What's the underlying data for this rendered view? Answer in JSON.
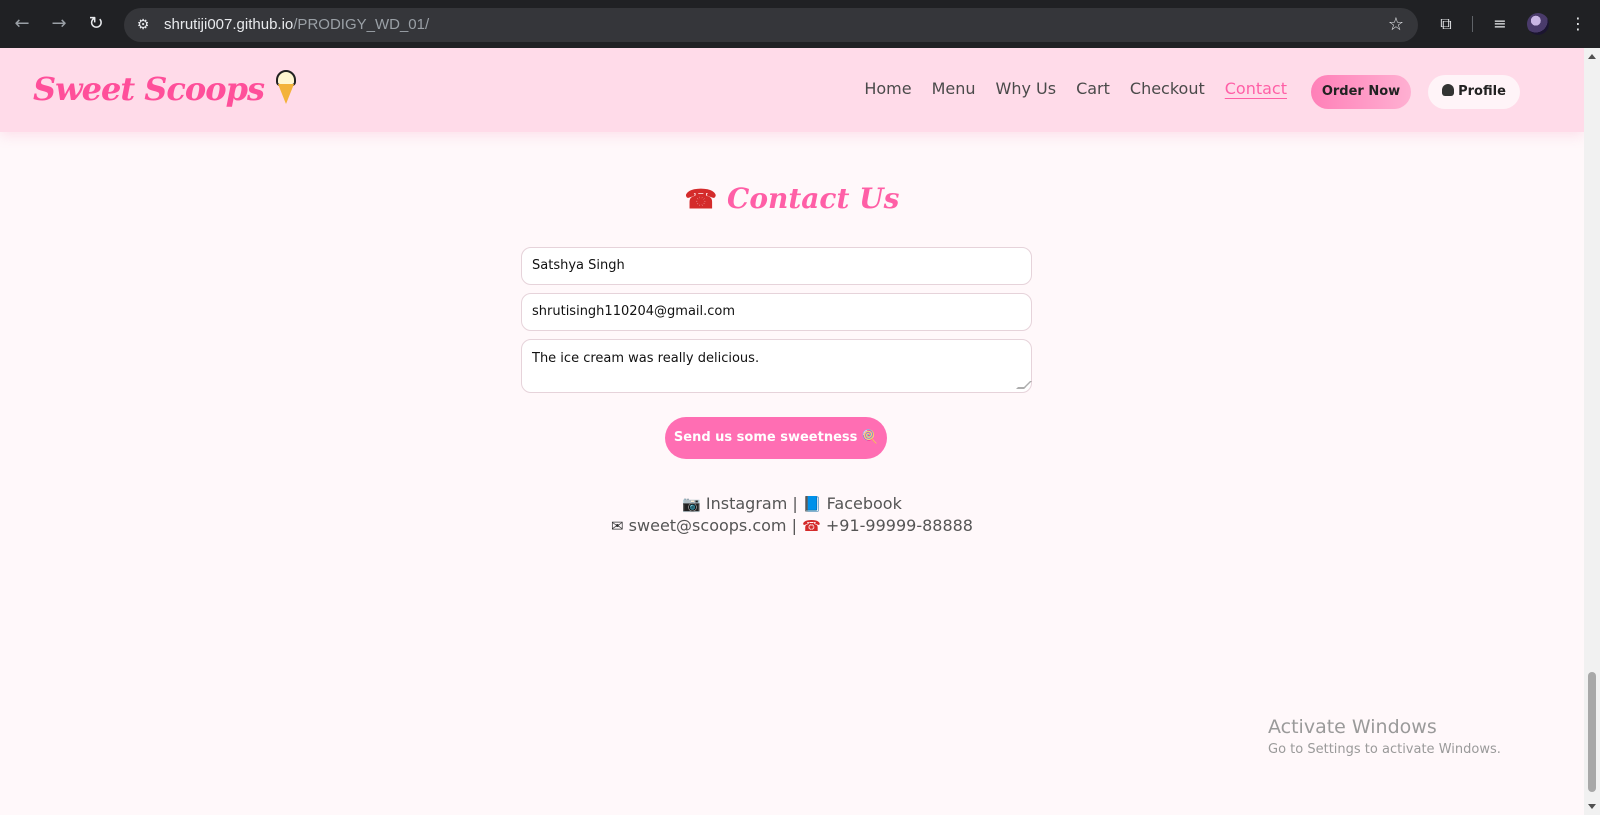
{
  "browser": {
    "url_host": "shrutiji007.github.io",
    "url_path": "/PRODIGY_WD_01/",
    "icons": [
      "back-icon",
      "forward-icon",
      "reload-icon",
      "site-settings-icon",
      "bookmark-star-icon",
      "extensions-icon",
      "media-controls-icon",
      "profile-avatar",
      "menu-icon"
    ]
  },
  "header": {
    "logo": "Sweet Scoops",
    "nav": [
      "Home",
      "Menu",
      "Why Us",
      "Cart",
      "Checkout",
      "Contact"
    ],
    "active_nav": "Contact",
    "order_button": "Order Now",
    "profile_button": "Profile"
  },
  "contact": {
    "title": "Contact Us",
    "name_value": "Satshya Singh",
    "email_value": "shrutisingh110204@gmail.com",
    "message_value": "The ice cream was really delicious.",
    "submit_label": "Send us some sweetness 🍭",
    "instagram": "Instagram",
    "facebook": "Facebook",
    "separator": "|",
    "email": "sweet@scoops.com",
    "phone": "+91-99999-88888"
  },
  "watermark": {
    "title": "Activate Windows",
    "subtitle": "Go to Settings to activate Windows."
  },
  "colors": {
    "brand_pink": "#ff5fa6",
    "header_bg": "#ffdbe9",
    "page_bg": "#fff8fa",
    "button_pink": "#ff6eb3"
  }
}
